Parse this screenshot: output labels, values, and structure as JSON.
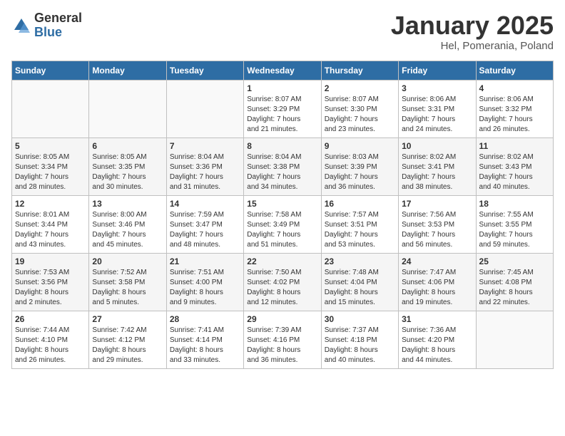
{
  "header": {
    "logo": {
      "general": "General",
      "blue": "Blue"
    },
    "title": "January 2025",
    "subtitle": "Hel, Pomerania, Poland"
  },
  "days_of_week": [
    "Sunday",
    "Monday",
    "Tuesday",
    "Wednesday",
    "Thursday",
    "Friday",
    "Saturday"
  ],
  "weeks": [
    [
      {
        "day": "",
        "info": ""
      },
      {
        "day": "",
        "info": ""
      },
      {
        "day": "",
        "info": ""
      },
      {
        "day": "1",
        "info": "Sunrise: 8:07 AM\nSunset: 3:29 PM\nDaylight: 7 hours\nand 21 minutes."
      },
      {
        "day": "2",
        "info": "Sunrise: 8:07 AM\nSunset: 3:30 PM\nDaylight: 7 hours\nand 23 minutes."
      },
      {
        "day": "3",
        "info": "Sunrise: 8:06 AM\nSunset: 3:31 PM\nDaylight: 7 hours\nand 24 minutes."
      },
      {
        "day": "4",
        "info": "Sunrise: 8:06 AM\nSunset: 3:32 PM\nDaylight: 7 hours\nand 26 minutes."
      }
    ],
    [
      {
        "day": "5",
        "info": "Sunrise: 8:05 AM\nSunset: 3:34 PM\nDaylight: 7 hours\nand 28 minutes."
      },
      {
        "day": "6",
        "info": "Sunrise: 8:05 AM\nSunset: 3:35 PM\nDaylight: 7 hours\nand 30 minutes."
      },
      {
        "day": "7",
        "info": "Sunrise: 8:04 AM\nSunset: 3:36 PM\nDaylight: 7 hours\nand 31 minutes."
      },
      {
        "day": "8",
        "info": "Sunrise: 8:04 AM\nSunset: 3:38 PM\nDaylight: 7 hours\nand 34 minutes."
      },
      {
        "day": "9",
        "info": "Sunrise: 8:03 AM\nSunset: 3:39 PM\nDaylight: 7 hours\nand 36 minutes."
      },
      {
        "day": "10",
        "info": "Sunrise: 8:02 AM\nSunset: 3:41 PM\nDaylight: 7 hours\nand 38 minutes."
      },
      {
        "day": "11",
        "info": "Sunrise: 8:02 AM\nSunset: 3:43 PM\nDaylight: 7 hours\nand 40 minutes."
      }
    ],
    [
      {
        "day": "12",
        "info": "Sunrise: 8:01 AM\nSunset: 3:44 PM\nDaylight: 7 hours\nand 43 minutes."
      },
      {
        "day": "13",
        "info": "Sunrise: 8:00 AM\nSunset: 3:46 PM\nDaylight: 7 hours\nand 45 minutes."
      },
      {
        "day": "14",
        "info": "Sunrise: 7:59 AM\nSunset: 3:47 PM\nDaylight: 7 hours\nand 48 minutes."
      },
      {
        "day": "15",
        "info": "Sunrise: 7:58 AM\nSunset: 3:49 PM\nDaylight: 7 hours\nand 51 minutes."
      },
      {
        "day": "16",
        "info": "Sunrise: 7:57 AM\nSunset: 3:51 PM\nDaylight: 7 hours\nand 53 minutes."
      },
      {
        "day": "17",
        "info": "Sunrise: 7:56 AM\nSunset: 3:53 PM\nDaylight: 7 hours\nand 56 minutes."
      },
      {
        "day": "18",
        "info": "Sunrise: 7:55 AM\nSunset: 3:55 PM\nDaylight: 7 hours\nand 59 minutes."
      }
    ],
    [
      {
        "day": "19",
        "info": "Sunrise: 7:53 AM\nSunset: 3:56 PM\nDaylight: 8 hours\nand 2 minutes."
      },
      {
        "day": "20",
        "info": "Sunrise: 7:52 AM\nSunset: 3:58 PM\nDaylight: 8 hours\nand 5 minutes."
      },
      {
        "day": "21",
        "info": "Sunrise: 7:51 AM\nSunset: 4:00 PM\nDaylight: 8 hours\nand 9 minutes."
      },
      {
        "day": "22",
        "info": "Sunrise: 7:50 AM\nSunset: 4:02 PM\nDaylight: 8 hours\nand 12 minutes."
      },
      {
        "day": "23",
        "info": "Sunrise: 7:48 AM\nSunset: 4:04 PM\nDaylight: 8 hours\nand 15 minutes."
      },
      {
        "day": "24",
        "info": "Sunrise: 7:47 AM\nSunset: 4:06 PM\nDaylight: 8 hours\nand 19 minutes."
      },
      {
        "day": "25",
        "info": "Sunrise: 7:45 AM\nSunset: 4:08 PM\nDaylight: 8 hours\nand 22 minutes."
      }
    ],
    [
      {
        "day": "26",
        "info": "Sunrise: 7:44 AM\nSunset: 4:10 PM\nDaylight: 8 hours\nand 26 minutes."
      },
      {
        "day": "27",
        "info": "Sunrise: 7:42 AM\nSunset: 4:12 PM\nDaylight: 8 hours\nand 29 minutes."
      },
      {
        "day": "28",
        "info": "Sunrise: 7:41 AM\nSunset: 4:14 PM\nDaylight: 8 hours\nand 33 minutes."
      },
      {
        "day": "29",
        "info": "Sunrise: 7:39 AM\nSunset: 4:16 PM\nDaylight: 8 hours\nand 36 minutes."
      },
      {
        "day": "30",
        "info": "Sunrise: 7:37 AM\nSunset: 4:18 PM\nDaylight: 8 hours\nand 40 minutes."
      },
      {
        "day": "31",
        "info": "Sunrise: 7:36 AM\nSunset: 4:20 PM\nDaylight: 8 hours\nand 44 minutes."
      },
      {
        "day": "",
        "info": ""
      }
    ]
  ]
}
